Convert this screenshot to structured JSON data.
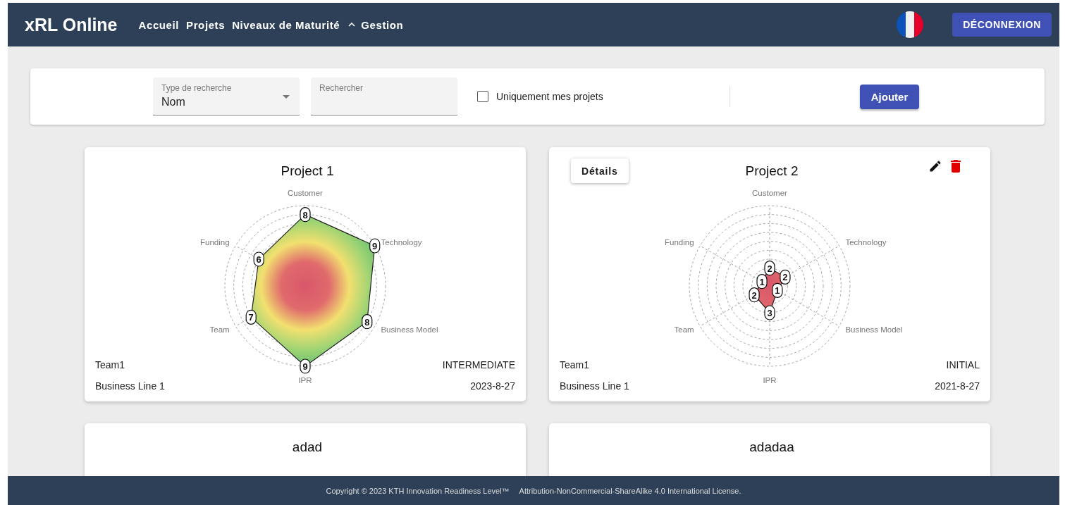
{
  "header": {
    "logo": "xRL Online",
    "nav": [
      {
        "label": "Accueil",
        "kind": "link"
      },
      {
        "label": "Projets",
        "kind": "link"
      },
      {
        "label": "Niveaux de Maturité",
        "kind": "link"
      },
      {
        "label": "Gestion",
        "kind": "menu",
        "expanded": true
      }
    ],
    "logout": "DÉCONNEXION"
  },
  "filters": {
    "search_type": {
      "label": "Type de recherche",
      "value": "Nom"
    },
    "search": {
      "label": "Rechercher"
    },
    "only_mine": {
      "label": "Uniquement mes projets",
      "checked": false
    },
    "add_button": "Ajouter"
  },
  "projects": [
    {
      "title": "Project 1",
      "actions_visible": false,
      "team": "Team1",
      "level": "INTERMEDIATE",
      "business_line": "Business Line 1",
      "date": "2023-8-27",
      "axes": [
        {
          "label": "Customer",
          "value": "8",
          "kind": "top"
        },
        {
          "label": "Funding",
          "value": "6",
          "kind": "upperleft"
        },
        {
          "label": "Technology",
          "value": "9",
          "kind": "upperright"
        },
        {
          "label": "Team",
          "value": "7",
          "kind": "lowerleft"
        },
        {
          "label": "Business Model",
          "value": "8",
          "kind": "lowerright"
        },
        {
          "label": "IPR",
          "value": "9",
          "kind": "bottom"
        }
      ]
    },
    {
      "title": "Project 2",
      "actions_visible": true,
      "details_label": "Détails",
      "team": "Team1",
      "level": "INITIAL",
      "business_line": "Business Line 1",
      "date": "2021-8-27",
      "axes": [
        {
          "label": "Customer",
          "value": "2",
          "kind": "top"
        },
        {
          "label": "Funding",
          "value": "1",
          "kind": "upperleft"
        },
        {
          "label": "Technology",
          "value": "2",
          "kind": "upperright"
        },
        {
          "label": "Team",
          "value": "2",
          "kind": "lowerleft"
        },
        {
          "label": "Business Model",
          "value": "1",
          "kind": "lowerright"
        },
        {
          "label": "IPR",
          "value": "3",
          "kind": "bottom"
        }
      ]
    },
    {
      "title": "adad"
    },
    {
      "title": "adadaa"
    }
  ],
  "footer": {
    "copyright": "Copyright © 2023 KTH Innovation Readiness Level™",
    "license": "Attribution-NonCommercial-ShareAlike 4.0 International License."
  }
}
